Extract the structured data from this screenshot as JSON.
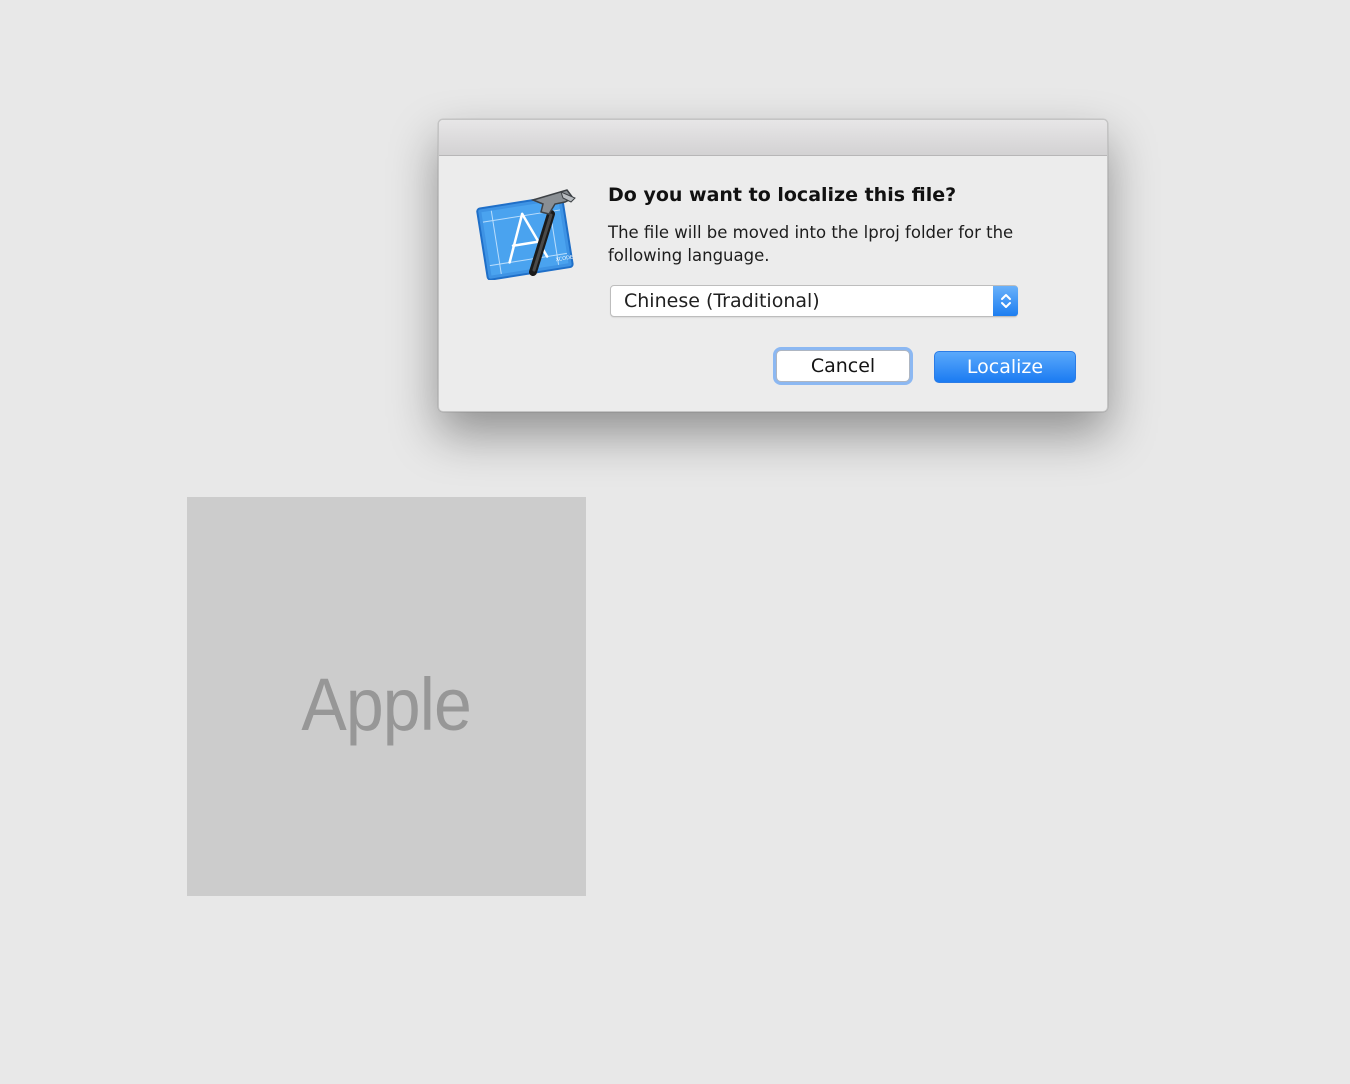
{
  "canvas": {
    "placeholder_label": "Apple"
  },
  "dialog": {
    "app_icon": "xcode-app-icon",
    "title": "Do you want to localize this file?",
    "message": "The file will be moved into the lproj folder for the following language.",
    "language_popup": {
      "selected": "Chinese (Traditional)",
      "icon": "up-down-arrows-icon"
    },
    "buttons": {
      "cancel": "Cancel",
      "localize": "Localize"
    }
  },
  "colors": {
    "accent": "#1b7bf2",
    "focus_ring": "#8cb8f2",
    "background": "#e8e8e8"
  }
}
